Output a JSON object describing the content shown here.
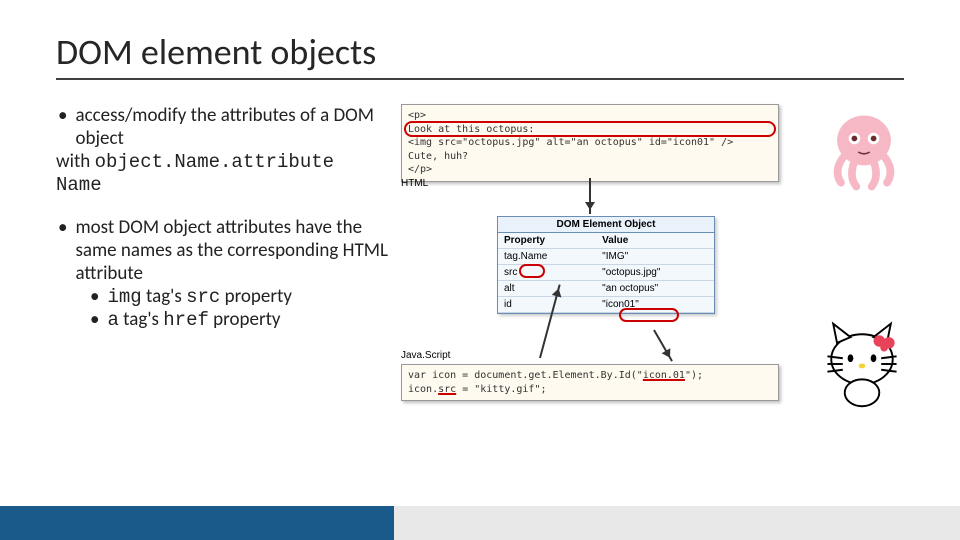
{
  "title": "DOM element objects",
  "bullets": {
    "b1a": "access/modify the attributes of a DOM object",
    "b1b_with": "with ",
    "b1b_obj": "object.Name",
    "b1b_dot": ".",
    "b1b_attr": "attribute Name",
    "b2": "most DOM object attributes have the same names as the corresponding HTML attribute",
    "b2s1_a": "img",
    "b2s1_b": " tag's ",
    "b2s1_c": "src",
    "b2s1_d": " property",
    "b2s2_a": "a",
    "b2s2_b": " tag's ",
    "b2s2_c": "href",
    "b2s2_d": " property"
  },
  "html_code": {
    "l1": "<p>",
    "l2": "  Look at this octopus:",
    "l3": "  <img src=\"octopus.jpg\" alt=\"an octopus\" id=\"icon01\" />",
    "l4": "  Cute, huh?",
    "l5": "</p>"
  },
  "labels": {
    "html": "HTML",
    "js": "Java.Script",
    "dom_title": "DOM Element Object"
  },
  "dom_table": {
    "h1": "Property",
    "h2": "Value",
    "r1a": "tag.Name",
    "r1b": "\"IMG\"",
    "r2a": "src",
    "r2b": "\"octopus.jpg\"",
    "r3a": "alt",
    "r3b": "\"an octopus\"",
    "r4a": "id",
    "r4b": "\"icon01\""
  },
  "js_code": {
    "l1a": "var icon = document.get.Element.By.Id(\"",
    "l1b": "icon.01",
    "l1c": "\");",
    "l2a": "icon.",
    "l2b": "src",
    "l2c": " = \"kitty.gif\";"
  }
}
